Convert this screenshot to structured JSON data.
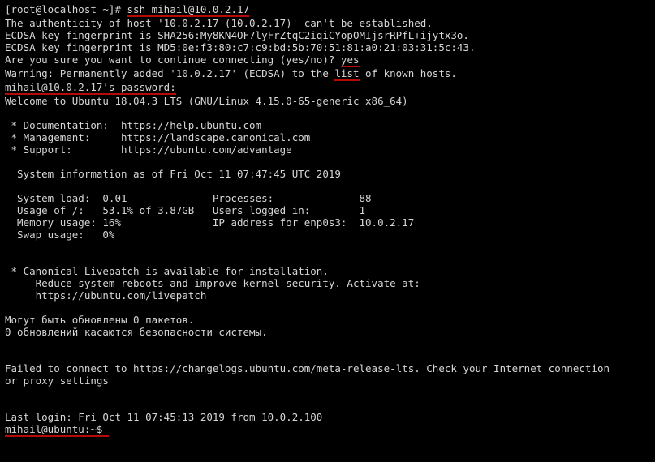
{
  "prompt1_user": "[root@localhost ~]# ",
  "prompt1_cmd": "ssh mihail@10.0.2.17",
  "auth_line": "The authenticity of host '10.0.2.17 (10.0.2.17)' can't be established.",
  "sha_line": "ECDSA key fingerprint is SHA256:My8KN4OF7lyFrZtqC2iqiCYopOMIjsrRPfL+ijytx3o.",
  "md5_line": "ECDSA key fingerprint is MD5:0e:f3:80:c7:c9:bd:5b:70:51:81:a0:21:03:31:5c:43.",
  "confirm_q": "Are you sure you want to continue connecting (yes/no)? ",
  "confirm_a": "yes",
  "warn_a": "Warning: Permanently added '10.0.2.17' (ECDSA) to the ",
  "warn_b": "list",
  "warn_c": " of known hosts.",
  "pw_prompt": "mihail@10.0.2.17's password:",
  "welcome": "Welcome to Ubuntu 18.04.3 LTS (GNU/Linux 4.15.0-65-generic x86_64)",
  "doc": " * Documentation:  https://help.ubuntu.com",
  "mgmt": " * Management:     https://landscape.canonical.com",
  "sup": " * Support:        https://ubuntu.com/advantage",
  "sysinfo_hdr": "  System information as of Fri Oct 11 07:47:45 UTC 2019",
  "row1": "  System load:  0.01              Processes:              88",
  "row2": "  Usage of /:   53.1% of 3.87GB   Users logged in:        1",
  "row3": "  Memory usage: 16%               IP address for enp0s3:  10.0.2.17",
  "row4": "  Swap usage:   0%",
  "livepatch1": " * Canonical Livepatch is available for installation.",
  "livepatch2": "   - Reduce system reboots and improve kernel security. Activate at:",
  "livepatch3": "     https://ubuntu.com/livepatch",
  "ru1": "Могут быть обновлены 0 пакетов.",
  "ru2": "0 обновлений касаются безопасности системы.",
  "fail1": "Failed to connect to https://changelogs.ubuntu.com/meta-release-lts. Check your Internet connection",
  "fail2": "or proxy settings",
  "lastlogin": "Last login: Fri Oct 11 07:45:13 2019 from 10.0.2.100",
  "prompt2": "mihail@ubuntu:~$ "
}
